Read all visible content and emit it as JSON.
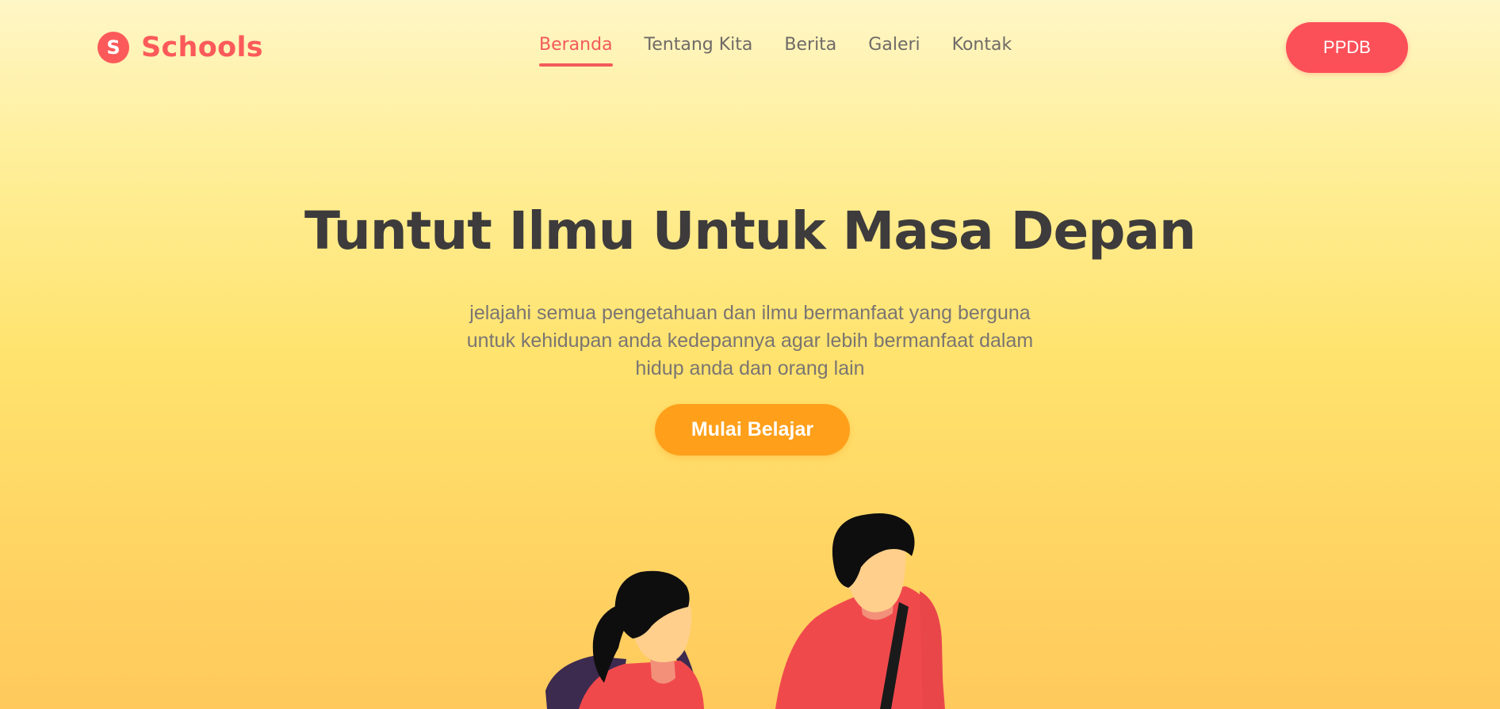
{
  "brand": {
    "logo_letter": "S",
    "name": "Schools",
    "color": "#fc5a5a"
  },
  "nav": {
    "items": [
      {
        "label": "Beranda",
        "active": true
      },
      {
        "label": "Tentang Kita",
        "active": false
      },
      {
        "label": "Berita",
        "active": false
      },
      {
        "label": "Galeri",
        "active": false
      },
      {
        "label": "Kontak",
        "active": false
      }
    ],
    "cta_label": "PPDB"
  },
  "hero": {
    "title": "Tuntut Ilmu Untuk Masa Depan",
    "description": "jelajahi semua pengetahuan dan ilmu bermanfaat yang berguna untuk kehidupan anda kedepannya agar lebih bermanfaat dalam hidup anda dan orang lain",
    "button_label": "Mulai Belajar"
  },
  "colors": {
    "accent_red": "#fc5059",
    "accent_orange": "#ff9f1a",
    "heading": "#3d3b3b",
    "body_text": "#7a7572"
  },
  "illustration": {
    "icon": "students-illustration"
  }
}
